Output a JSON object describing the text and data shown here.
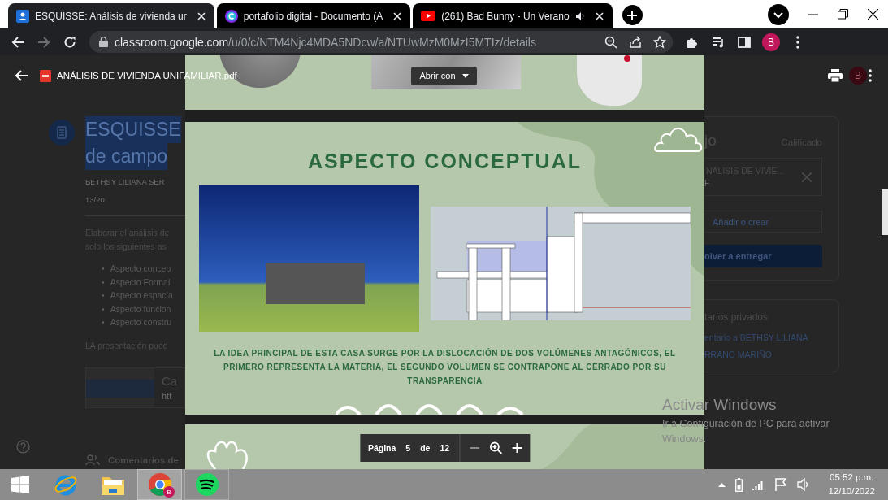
{
  "browser": {
    "tabs": [
      {
        "kind": "classroom",
        "title": "ESQUISSE: Análisis de vivienda ur",
        "selected": true,
        "playing_audio": false
      },
      {
        "kind": "canva",
        "title": "portafolio digital - Documento (A",
        "selected": false,
        "playing_audio": false
      },
      {
        "kind": "youtube",
        "title": "(261) Bad Bunny - Un Verano",
        "selected": false,
        "playing_audio": true
      }
    ],
    "forward_disabled": true,
    "address": {
      "host": "classroom.google.com",
      "path": "/u/0/c/NTM4Njc4MDA5NDcw/a/NTUwMzM0MzI5MTIz/details"
    },
    "profile_initial": "B"
  },
  "assignment": {
    "title_lines": [
      "ESQUISSE",
      "de campo"
    ],
    "author": "BETHSY LILIANA SER",
    "score": "13/20",
    "bullet_mark": "•",
    "intro_lines": [
      "Elaborar el análisis de",
      "solo los siguientes as"
    ],
    "bullets": [
      "Aspecto concep",
      "Aspecto Formal",
      "Aspecto espacia",
      "Aspecto funcion",
      "Aspecto constru"
    ],
    "note": "LA presentación pued",
    "attachment": {
      "title": "Ca",
      "link": "htt"
    },
    "comments": "Comentarios de"
  },
  "work_panel": {
    "title": "jo",
    "status": "Calificado",
    "file": {
      "name": "NÁLISIS DE VIVIE...",
      "type": "F"
    },
    "add_button": "Añadir o crear",
    "submit_button": "olver a entregar",
    "private_comments": {
      "title": "tarios privados",
      "lines": [
        "entario a BETHSY LILIANA",
        "RRANO MARIÑO"
      ]
    }
  },
  "viewer": {
    "file_name": "ANÁLISIS DE VIVIENDA UNIFAMILIAR.pdf",
    "open_with": "Abrir con",
    "avatar_initial": "B",
    "slide": {
      "title": "ASPECTO CONCEPTUAL",
      "caption": "LA IDEA PRINCIPAL DE ESTA CASA SURGE POR LA DISLOCACIÓN DE DOS VOLÚMENES ANTAGÓNICOS, EL PRIMERO REPRESENTA LA MATERIA, EL SEGUNDO VOLUMEN SE CONTRAPONE AL CERRADO POR SU TRANSPARENCIA"
    },
    "pager": {
      "label": "Página",
      "page": "5",
      "of": "de",
      "total": "12"
    }
  },
  "activation": {
    "title": "Activar Windows",
    "lines": [
      "Ir a Configuración de PC para activar",
      "Windows."
    ]
  },
  "taskbar": {
    "apps": [
      {
        "kind": "ie",
        "selected": false,
        "running": false
      },
      {
        "kind": "explorer",
        "selected": false,
        "running": false
      },
      {
        "kind": "chrome",
        "selected": true,
        "running": true,
        "badge": "B"
      },
      {
        "kind": "spotify",
        "selected": false,
        "running": true
      }
    ],
    "time": "05:52 p.m.",
    "date": "12/10/2022"
  }
}
